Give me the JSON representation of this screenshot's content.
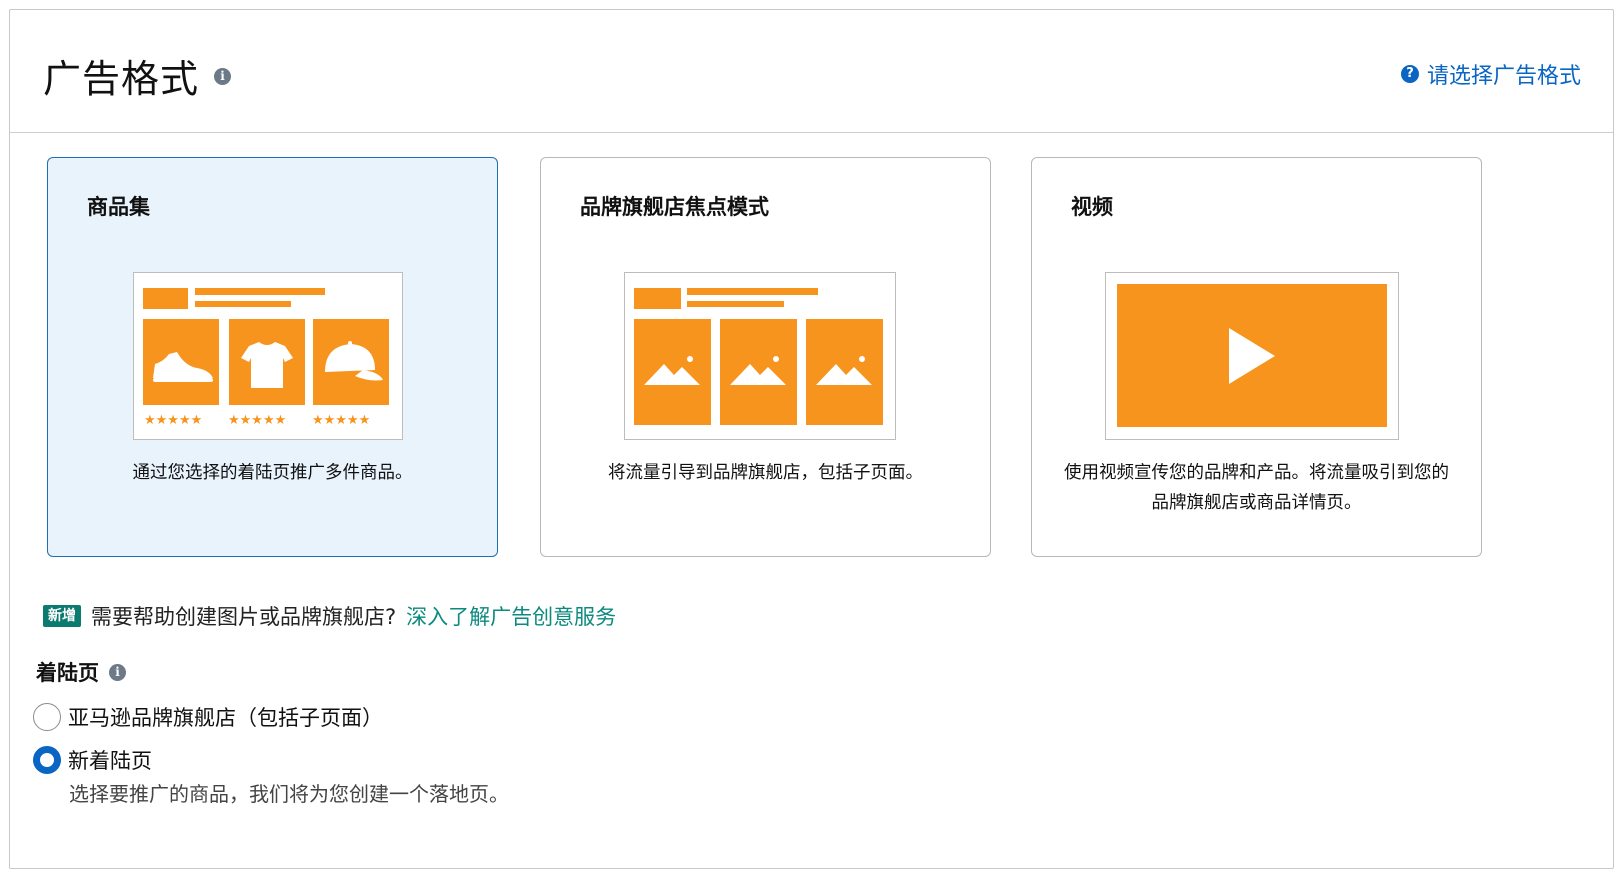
{
  "header": {
    "title": "广告格式",
    "title_info_icon": "i",
    "help_link": "请选择广告格式",
    "help_icon": "?"
  },
  "cards": [
    {
      "title": "商品集",
      "description": "通过您选择的着陆页推广多件商品。",
      "selected": true
    },
    {
      "title": "品牌旗舰店焦点模式",
      "description": "将流量引导到品牌旗舰店，包括子页面。",
      "selected": false
    },
    {
      "title": "视频",
      "description": "使用视频宣传您的品牌和产品。将流量吸引到您的品牌旗舰店或商品详情页。",
      "selected": false
    }
  ],
  "promo": {
    "badge": "新增",
    "text": "需要帮助创建图片或品牌旗舰店?",
    "link": "深入了解广告创意服务"
  },
  "landing": {
    "title": "着陆页",
    "info_icon": "i",
    "options": [
      {
        "label": "亚马逊品牌旗舰店（包括子页面）",
        "checked": false
      },
      {
        "label": "新着陆页",
        "checked": true,
        "sublabel": "选择要推广的商品，我们将为您创建一个落地页。"
      }
    ]
  },
  "colors": {
    "accent_orange": "#f7941d",
    "link_blue": "#0a66c2",
    "selected_bg": "#e9f3fc",
    "badge_green": "#0b7a6f"
  }
}
